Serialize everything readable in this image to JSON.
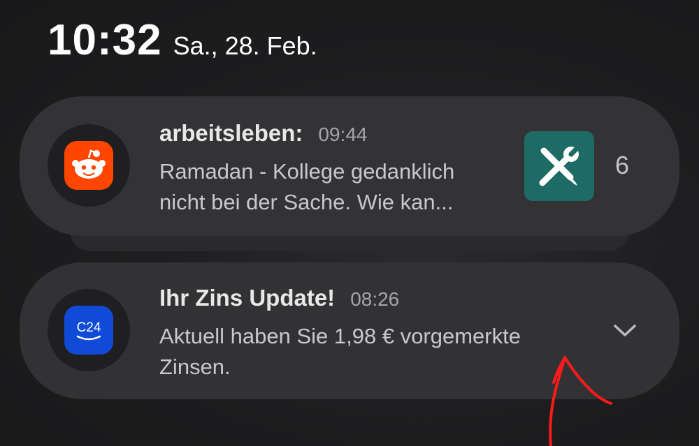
{
  "status": {
    "clock": "10:32",
    "date": "Sa., 28. Feb."
  },
  "notifications": [
    {
      "app_icon": "reddit-icon",
      "title": "arbeitsleben:",
      "time": "09:44",
      "body_line1": "Ramadan - Kollege gedanklich",
      "body_line2": "nicht bei der Sache. Wie kan...",
      "side_icon": "tools-icon",
      "count": "6"
    },
    {
      "app_icon": "c24-icon",
      "app_icon_text": "C24",
      "title": "Ihr Zins Update!",
      "time": "08:26",
      "body_line1": "Aktuell haben Sie 1,98 € vorgemerkte",
      "body_line2": "Zinsen.",
      "expand_icon": "chevron-down-icon"
    }
  ],
  "colors": {
    "reddit": "#ff4500",
    "c24": "#0f4bd6",
    "tools": "#1e6b66",
    "annotation": "#ff1a1a"
  }
}
